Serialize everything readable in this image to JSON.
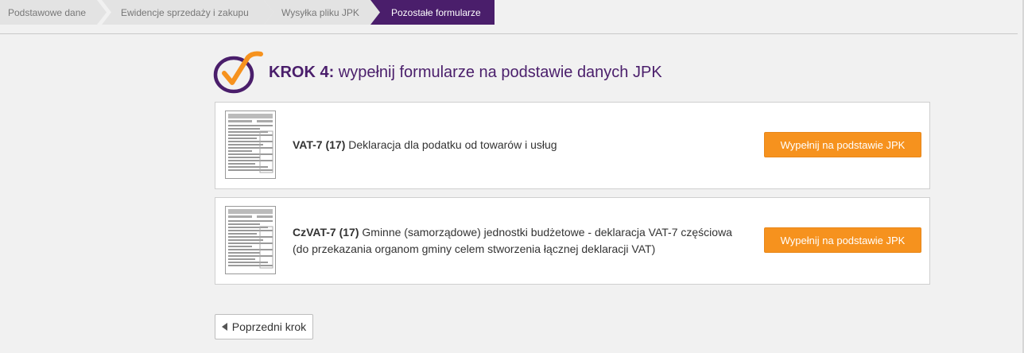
{
  "steps": [
    {
      "label": "Podstawowe dane",
      "active": false
    },
    {
      "label": "Ewidencje sprzedaży i zakupu",
      "active": false
    },
    {
      "label": "Wysyłka pliku JPK",
      "active": false
    },
    {
      "label": "Pozostałe formularze",
      "active": true
    }
  ],
  "header": {
    "step_label": "KROK 4:",
    "title": " wypełnij formularze na podstawie danych JPK"
  },
  "forms": [
    {
      "code": "VAT-7 (17)",
      "description": " Deklaracja dla podatku od towarów i usług",
      "button": "Wypełnij na podstawie JPK"
    },
    {
      "code": "CzVAT-7 (17)",
      "description": " Gminne (samorządowe) jednostki budżetowe - deklaracja VAT-7 częściowa (do przekazania organom gminy celem stworzenia łącznej deklaracji VAT)",
      "button": "Wypełnij na podstawie JPK"
    }
  ],
  "footer": {
    "prev_label": "Poprzedni krok"
  },
  "colors": {
    "accent_orange": "#f6921e",
    "brand_purple": "#4a1e6b",
    "step_inactive": "#e3e3e3",
    "step_active": "#4a1e6b"
  }
}
